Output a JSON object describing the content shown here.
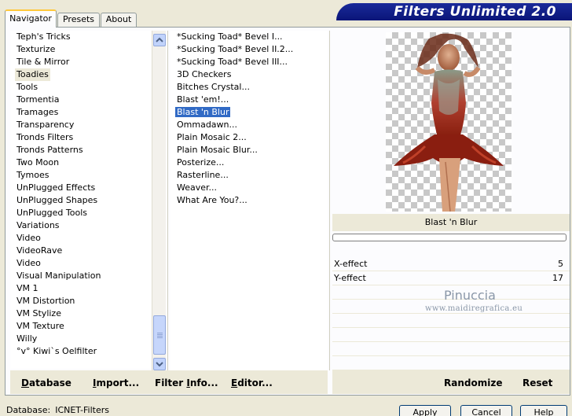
{
  "tabs": [
    "Navigator",
    "Presets",
    "About"
  ],
  "title": "Filters Unlimited 2.0",
  "categories": [
    "Teph's Tricks",
    "Texturize",
    "Tile & Mirror",
    "Toadies",
    "Tools",
    "Tormentia",
    "Tramages",
    "Transparency",
    "Tronds Filters",
    "Tronds Patterns",
    "Two Moon",
    "Tymoes",
    "UnPlugged Effects",
    "UnPlugged Shapes",
    "UnPlugged Tools",
    "Variations",
    "Video",
    "VideoRave",
    "Video",
    "Visual Manipulation",
    "VM 1",
    "VM Distortion",
    "VM Stylize",
    "VM Texture",
    "Willy",
    "°v° Kiwi`s Oelfilter"
  ],
  "selected_category": "Toadies",
  "filters": [
    "*Sucking Toad*  Bevel I...",
    "*Sucking Toad*  Bevel II.2...",
    "*Sucking Toad*  Bevel III...",
    "3D Checkers",
    "Bitches Crystal...",
    "Blast 'em!...",
    "Blast 'n Blur",
    "Ommadawn...",
    "Plain Mosaic 2...",
    "Plain Mosaic Blur...",
    "Posterize...",
    "Rasterline...",
    "Weaver...",
    "What Are You?..."
  ],
  "selected_filter": "Blast 'n Blur",
  "preview_filter_name": "Blast 'n Blur",
  "params": [
    {
      "label": "X-effect",
      "value": "5"
    },
    {
      "label": "Y-effect",
      "value": "17"
    }
  ],
  "watermark": {
    "line1": "Pinuccia",
    "line2": "www.maidiregrafica.eu"
  },
  "bottom_buttons": {
    "database": {
      "u": "D",
      "rest": "atabase"
    },
    "import": {
      "u": "I",
      "rest": "mport..."
    },
    "filter_info": {
      "pre": "Filter ",
      "u": "I",
      "rest": "nfo..."
    },
    "editor": {
      "u": "E",
      "rest": "ditor..."
    },
    "randomize": "Randomize",
    "reset": "Reset"
  },
  "status": {
    "label": "Database:",
    "value": "ICNET-Filters"
  },
  "dialog_buttons": [
    "Apply",
    "Cancel",
    "Help"
  ],
  "colors": {
    "accent": "#316ac5",
    "banner": "#0a1578",
    "tab_highlight": "#ffc83c"
  }
}
